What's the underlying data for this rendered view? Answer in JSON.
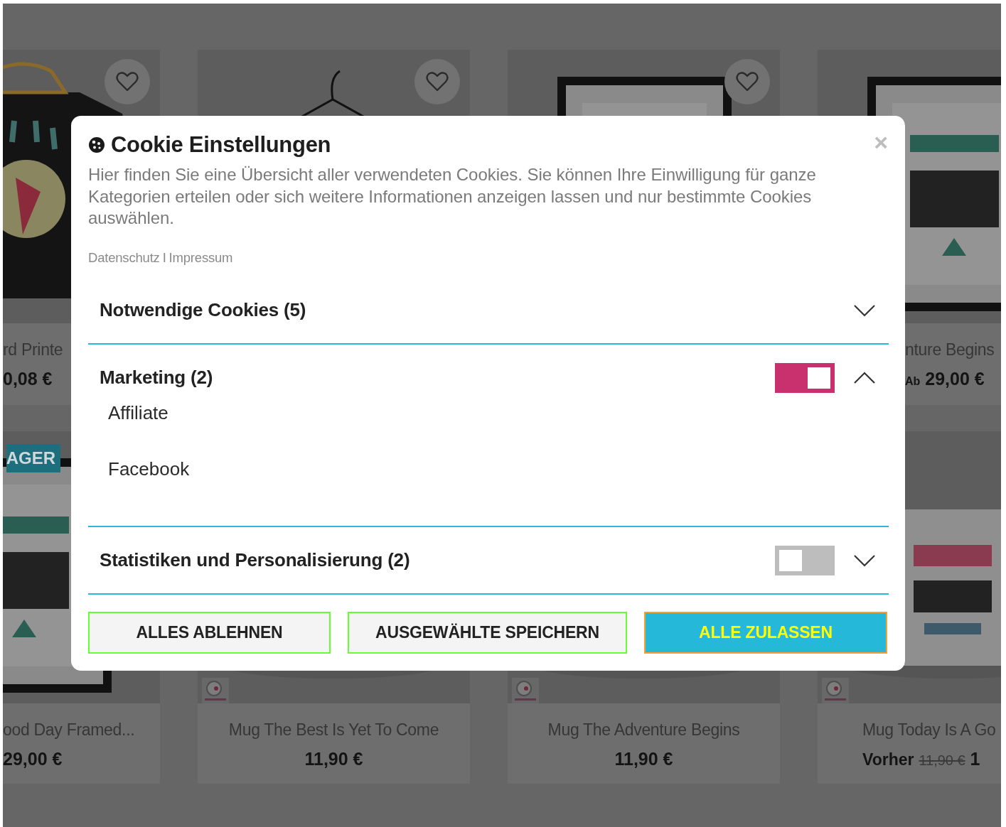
{
  "products": [
    {
      "favorite": true,
      "title": "rd Printe",
      "price": "0,08 €"
    },
    {
      "favorite": true
    },
    {
      "favorite": true
    },
    {
      "favorite": false,
      "title": "nture Begins",
      "price_prefix": "Ab",
      "price": "29,00 €"
    },
    {
      "badge": "AGER",
      "title": "ood Day Framed...",
      "price": "29,00 €"
    },
    {
      "shop_logo": true,
      "title": "Mug The Best Is Yet To Come",
      "price": "11,90 €"
    },
    {
      "shop_logo": true,
      "title": "Mug The Adventure Begins",
      "price": "11,90 €"
    },
    {
      "shop_logo": true,
      "title": "Mug Today Is A Go",
      "price_prefix": "Vorher",
      "old_price": "11,90 €",
      "price": "1"
    }
  ],
  "dialog": {
    "title": "Cookie Einstellungen",
    "close": "×",
    "description": "Hier finden Sie eine Übersicht aller verwendeten Cookies. Sie können Ihre Einwilligung für ganze Kategorien erteilen oder sich weitere Informationen anzeigen lassen und nur bestimmte Cookies auswählen.",
    "links": [
      {
        "label": "Datenschutz"
      },
      {
        "label": "Impressum"
      }
    ],
    "link_separator": "I",
    "categories": [
      {
        "name": "Notwendige Cookies (5)",
        "expanded": false
      },
      {
        "name": "Marketing (2)",
        "expanded": true,
        "on": true,
        "children": [
          {
            "name": "Affiliate"
          },
          {
            "name": "Facebook"
          }
        ]
      },
      {
        "name": "Statistiken und Personalisierung (2)",
        "expanded": false,
        "on": false
      }
    ],
    "buttons": [
      {
        "label": "ALLES ABLEHNEN",
        "kind": "secondary"
      },
      {
        "label": "AUSGEWÄHLTE SPEICHERN",
        "kind": "secondary"
      },
      {
        "label": "ALLE ZULASSEN",
        "kind": "primary"
      }
    ]
  }
}
